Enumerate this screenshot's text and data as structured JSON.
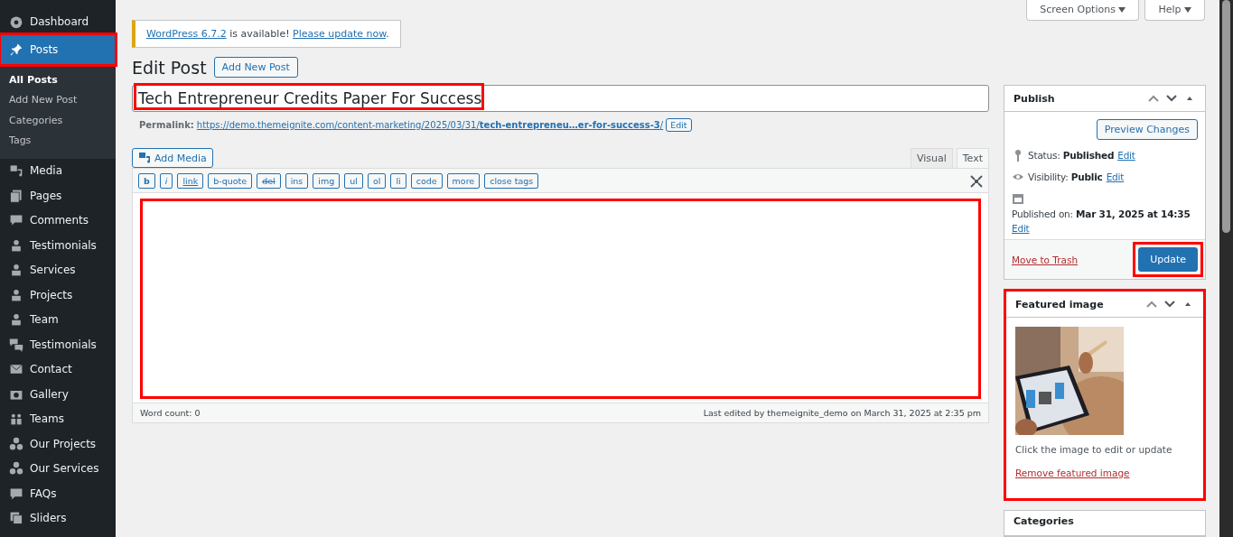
{
  "sidebar": {
    "items": [
      {
        "label": "Dashboard",
        "selected": false
      },
      {
        "label": "Posts",
        "selected": true,
        "highlighted": true,
        "children": [
          {
            "label": "All Posts",
            "selected": true
          },
          {
            "label": "Add New Post",
            "selected": false
          },
          {
            "label": "Categories",
            "selected": false
          },
          {
            "label": "Tags",
            "selected": false
          }
        ]
      },
      {
        "label": "Media",
        "selected": false
      },
      {
        "label": "Pages",
        "selected": false
      },
      {
        "label": "Comments",
        "selected": false
      },
      {
        "label": "Testimonials",
        "selected": false
      },
      {
        "label": "Services",
        "selected": false
      },
      {
        "label": "Projects",
        "selected": false
      },
      {
        "label": "Team",
        "selected": false
      },
      {
        "label": "Testimonials",
        "selected": false
      },
      {
        "label": "Contact",
        "selected": false
      },
      {
        "label": "Gallery",
        "selected": false
      },
      {
        "label": "Teams",
        "selected": false
      },
      {
        "label": "Our Projects",
        "selected": false
      },
      {
        "label": "Our Services",
        "selected": false
      },
      {
        "label": "FAQs",
        "selected": false
      },
      {
        "label": "Sliders",
        "selected": false
      }
    ]
  },
  "top_buttons": [
    "Screen Options",
    "Help"
  ],
  "notice": {
    "link": "WordPress 6.7.2",
    "text": "is available!",
    "action": "Please update now",
    "end": "."
  },
  "heading": "Edit Post",
  "add_new": "Add New Post",
  "title_field": {
    "value": "Tech Entrepreneur Credits Paper For Success",
    "highlighted": true
  },
  "permalink": {
    "label": "Permalink:",
    "url": "https://demo.themeignite.com/content-marketing/2025/03/31/",
    "slug": "tech-entrepreneu…er-for-success-3",
    "end": "/",
    "edit": "Edit"
  },
  "add_media": "Add Media",
  "editor_tabs": [
    {
      "label": "Visual",
      "selected": false
    },
    {
      "label": "Text",
      "selected": true
    }
  ],
  "quicktags": [
    "b",
    "i",
    "link",
    "b-quote",
    "del",
    "ins",
    "img",
    "ul",
    "ol",
    "li",
    "code",
    "more",
    "close tags"
  ],
  "editor": {
    "highlighted": true
  },
  "word_count": "Word count: 0",
  "last_edited": "Last edited by themeignite_demo on March 31, 2025 at 2:35 pm",
  "publish": {
    "title": "Publish",
    "preview": "Preview Changes",
    "rows": [
      {
        "label": "Status:",
        "value": "Published",
        "edit": "Edit"
      },
      {
        "label": "Visibility:",
        "value": "Public",
        "edit": "Edit"
      },
      {
        "label": "Published on:",
        "value": "Mar 31, 2025 at 14:35",
        "edit": "Edit"
      }
    ],
    "trash": "Move to Trash",
    "update": "Update",
    "update_highlighted": true
  },
  "featured": {
    "title": "Featured image",
    "hint": "Click the image to edit or update",
    "remove": "Remove featured image",
    "highlighted": true
  },
  "categories": {
    "title": "Categories"
  }
}
